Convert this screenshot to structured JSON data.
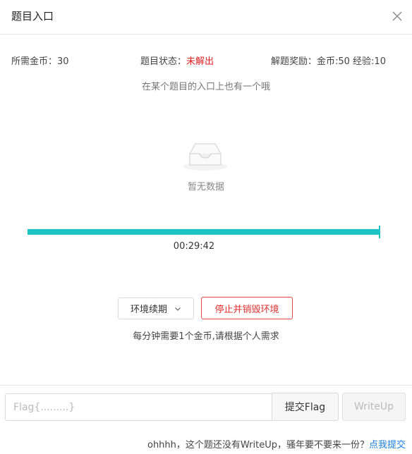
{
  "dialog": {
    "title": "题目入口",
    "close_icon": "close-icon"
  },
  "info": {
    "cost": "所需金币：30",
    "status_label": "题目状态：",
    "status_value": "未解出",
    "status_color": "#e02020",
    "reward": "解题奖励：金币:50 经验:10"
  },
  "hint": "在某个题目的入口上也有一个哦",
  "empty": {
    "icon": "empty-inbox-icon",
    "text": "暂无数据"
  },
  "timer": {
    "remaining": "00:29:42",
    "progress_fraction": 0.996,
    "accent_color": "#1ec3c3"
  },
  "actions": {
    "renew_label": "环境续期",
    "renew_icon": "chevron-down-icon",
    "stop_label": "停止并销毁环境",
    "cost_note": "每分钟需要1个金币,请根据个人需求"
  },
  "flag": {
    "placeholder": "Flag{.........}",
    "value": "",
    "submit_label": "提交Flag",
    "writeup_label": "WriteUp"
  },
  "footer": {
    "note": "ohhhh，这个题还没有WriteUp，骚年要不要来一份？",
    "link": "点我提交",
    "link_color": "#1a7fe0"
  }
}
